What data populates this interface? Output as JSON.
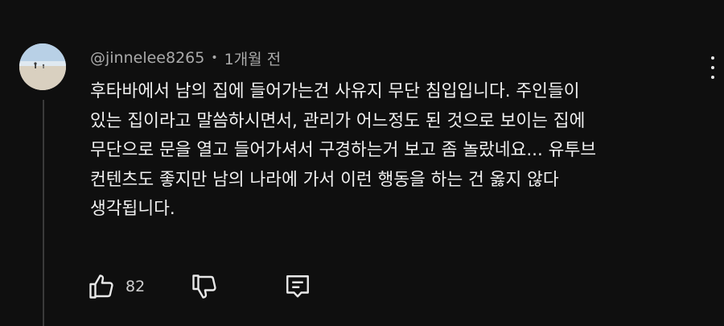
{
  "comment": {
    "author": "@jinnelee8265",
    "separator": "•",
    "time_ago": "1개월 전",
    "text_lines": [
      "후타바에서 남의 집에 들어가는건 사유지 무단 침입입니다. 주인들이",
      "있는 집이라고 말씀하시면서, 관리가 어느정도 된 것으로 보이는 집에",
      "무단으로 문을 열고 들어가셔서 구경하는거 보고 좀 놀랐네요... 유투브",
      "컨텐츠도 좋지만 남의 나라에 가서 이런 행동을 하는 건 옳지 않다",
      "생각됩니다."
    ],
    "like_count": "82"
  },
  "icons": {
    "like": "thumb-up-icon",
    "dislike": "thumb-down-icon",
    "reply": "reply-comment-icon",
    "more": "more-vertical-icon"
  },
  "colors": {
    "background": "#0f0f0f",
    "text": "#f1f1f1",
    "meta": "#aaaaaa"
  }
}
